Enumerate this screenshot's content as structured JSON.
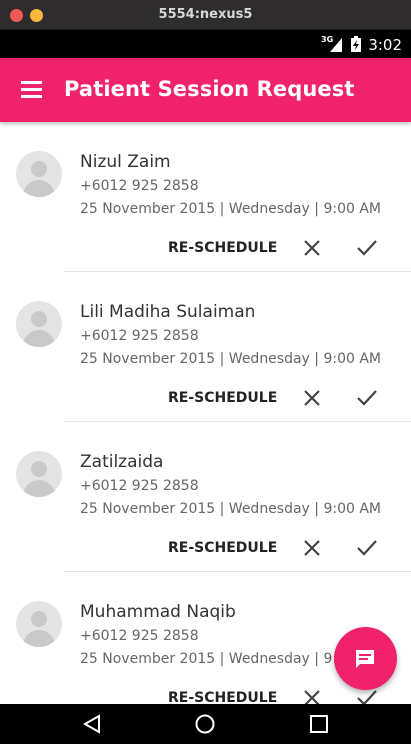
{
  "window": {
    "title": "5554:nexus5"
  },
  "status_bar": {
    "network": "3G",
    "time": "3:02"
  },
  "app_bar": {
    "title": "Patient Session Request",
    "menu_icon": "hamburger-menu-icon"
  },
  "requests": [
    {
      "name": "Nizul Zaim",
      "phone": "+6012 925 2858",
      "datetime": "25 November 2015 | Wednesday | 9:00 AM",
      "reschedule_label": "RE-SCHEDULE"
    },
    {
      "name": "Lili Madiha Sulaiman",
      "phone": "+6012 925 2858",
      "datetime": "25 November 2015 | Wednesday | 9:00 AM",
      "reschedule_label": "RE-SCHEDULE"
    },
    {
      "name": "Zatilzaida",
      "phone": "+6012 925 2858",
      "datetime": "25 November 2015 | Wednesday | 9:00 AM",
      "reschedule_label": "RE-SCHEDULE"
    },
    {
      "name": "Muhammad Naqib",
      "phone": "+6012 925 2858",
      "datetime": "25 November 2015 | Wednesday | 9:00 AM",
      "reschedule_label": "RE-SCHEDULE"
    }
  ],
  "fab": {
    "icon": "chat-message-icon"
  },
  "nav_bar": {
    "icons": [
      "back-icon",
      "home-icon",
      "recents-icon"
    ]
  },
  "colors": {
    "accent": "#f0226c",
    "status_bar": "#000000",
    "titlebar": "#2e2c2d"
  }
}
